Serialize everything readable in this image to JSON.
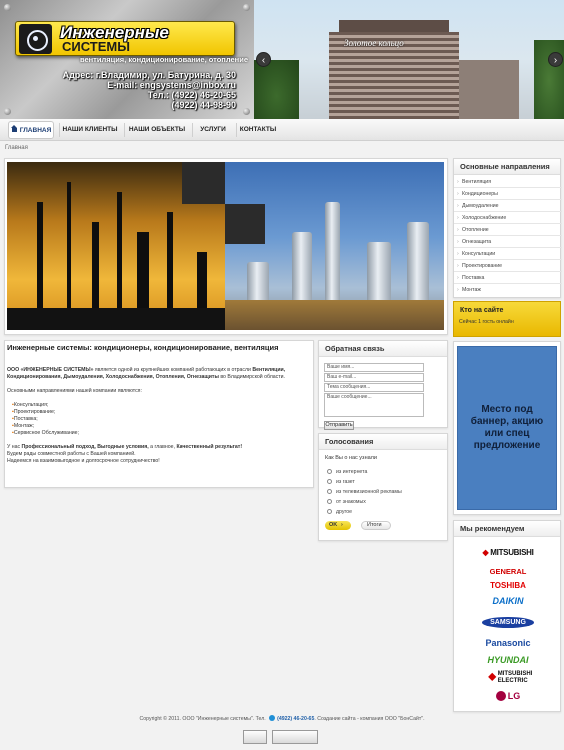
{
  "header": {
    "logo_line1": "Инженерные",
    "logo_line2": "СИСТЕМЫ",
    "slogan": "вентиляция, кондиционирование, отопление",
    "address": "Адрес: г.Владимир, ул. Батурина, д. 30",
    "email": "E-mail: engsystems@inbox.ru",
    "tel1": "Тел.:  (4922) 46-20-65",
    "tel2": "(4922) 44-98-90",
    "slide_sign": "Золотое кольцо"
  },
  "nav": {
    "items": [
      {
        "label": "ГЛАВНАЯ"
      },
      {
        "label": "НАШИ КЛИЕНТЫ"
      },
      {
        "label": "НАШИ ОБЪЕКТЫ"
      },
      {
        "label": "УСЛУГИ"
      },
      {
        "label": "КОНТАКТЫ"
      }
    ]
  },
  "breadcrumb": "Главная",
  "article": {
    "title": "Инженерные системы: кондиционеры, кондиционирование, вентиляция",
    "p1_a": "ООО «ИНЖЕНЕРНЫЕ СИСТЕМЫ»",
    "p1_b": " является одной из крупнейших компаний работающих в отрасли ",
    "p1_c": "Вентиляции, Кондиционирования, Дымоудаления, Холодоснабжения, Отопления, Огнезащиты",
    "p1_d": " во Владимирской области.",
    "p2": "Основными направлениями нашей компании являются:",
    "list": [
      "Консультация;",
      "Проектирование;",
      "Поставка;",
      "Монтаж;",
      "Сервисное Обслуживание;"
    ],
    "p3_a": "У нас ",
    "p3_b": "Профессиональный подход, Выгодные условия,",
    "p3_c": " а главное, ",
    "p3_d": "Качественный результат!",
    "p4": "Будем рады совместной работы с Вашей компанией.",
    "p5": "Надеемся на взаимовыгодное и долгосрочное сотрудничество!"
  },
  "feedback": {
    "title": "Обратная связь",
    "name_placeholder": "Ваше имя...",
    "email_placeholder": "Ваш e-mail...",
    "subject_placeholder": "Тема сообщения...",
    "message_placeholder": "Ваше сообщение...",
    "submit": "Отправить"
  },
  "poll": {
    "title": "Голосования",
    "question": "Как Вы о нас узнали",
    "options": [
      "из интернета",
      "из газет",
      "из телевизионной рекламы",
      "от знакомых",
      "другое"
    ],
    "ok": "OK",
    "results": "Итоги"
  },
  "sidebar": {
    "title": "Основные направления",
    "items": [
      "Вентиляция",
      "Кондиционеры",
      "Дымоудаление",
      "Холодоснабжение",
      "Отопление",
      "Огнезащита",
      "Консультации",
      "Проектирование",
      "Поставка",
      "Монтаж"
    ]
  },
  "who": {
    "title": "Кто на сайте",
    "text": "Сейчас 1 гость онлайн"
  },
  "ad": {
    "text": "Место под баннер, акцию или спец предложение"
  },
  "recommend": {
    "title": "Мы рекомендуем",
    "brands": [
      {
        "name": "MITSUBISHI",
        "color": "#d10000"
      },
      {
        "name": "GENERAL",
        "color": "#d10000"
      },
      {
        "name": "TOSHIBA",
        "color": "#e20000"
      },
      {
        "name": "DAIKIN",
        "color": "#0a6ec8"
      },
      {
        "name": "SAMSUNG",
        "color": "#1a3fa0"
      },
      {
        "name": "Panasonic",
        "color": "#1a4aa0"
      },
      {
        "name": "HYUNDAI",
        "color": "#3a9a25"
      },
      {
        "name": "MITSUBISHI ELECTRIC",
        "color": "#d10000"
      },
      {
        "name": "LG",
        "color": "#a3003f"
      }
    ]
  },
  "footer": {
    "copy": "Copyright © 2011. ООО \"Инженерные системы\". Тел.",
    "phone": "(4922) 46-20-65",
    "made": ". Создание сайта - компания ООО \"БонСайт\"."
  }
}
